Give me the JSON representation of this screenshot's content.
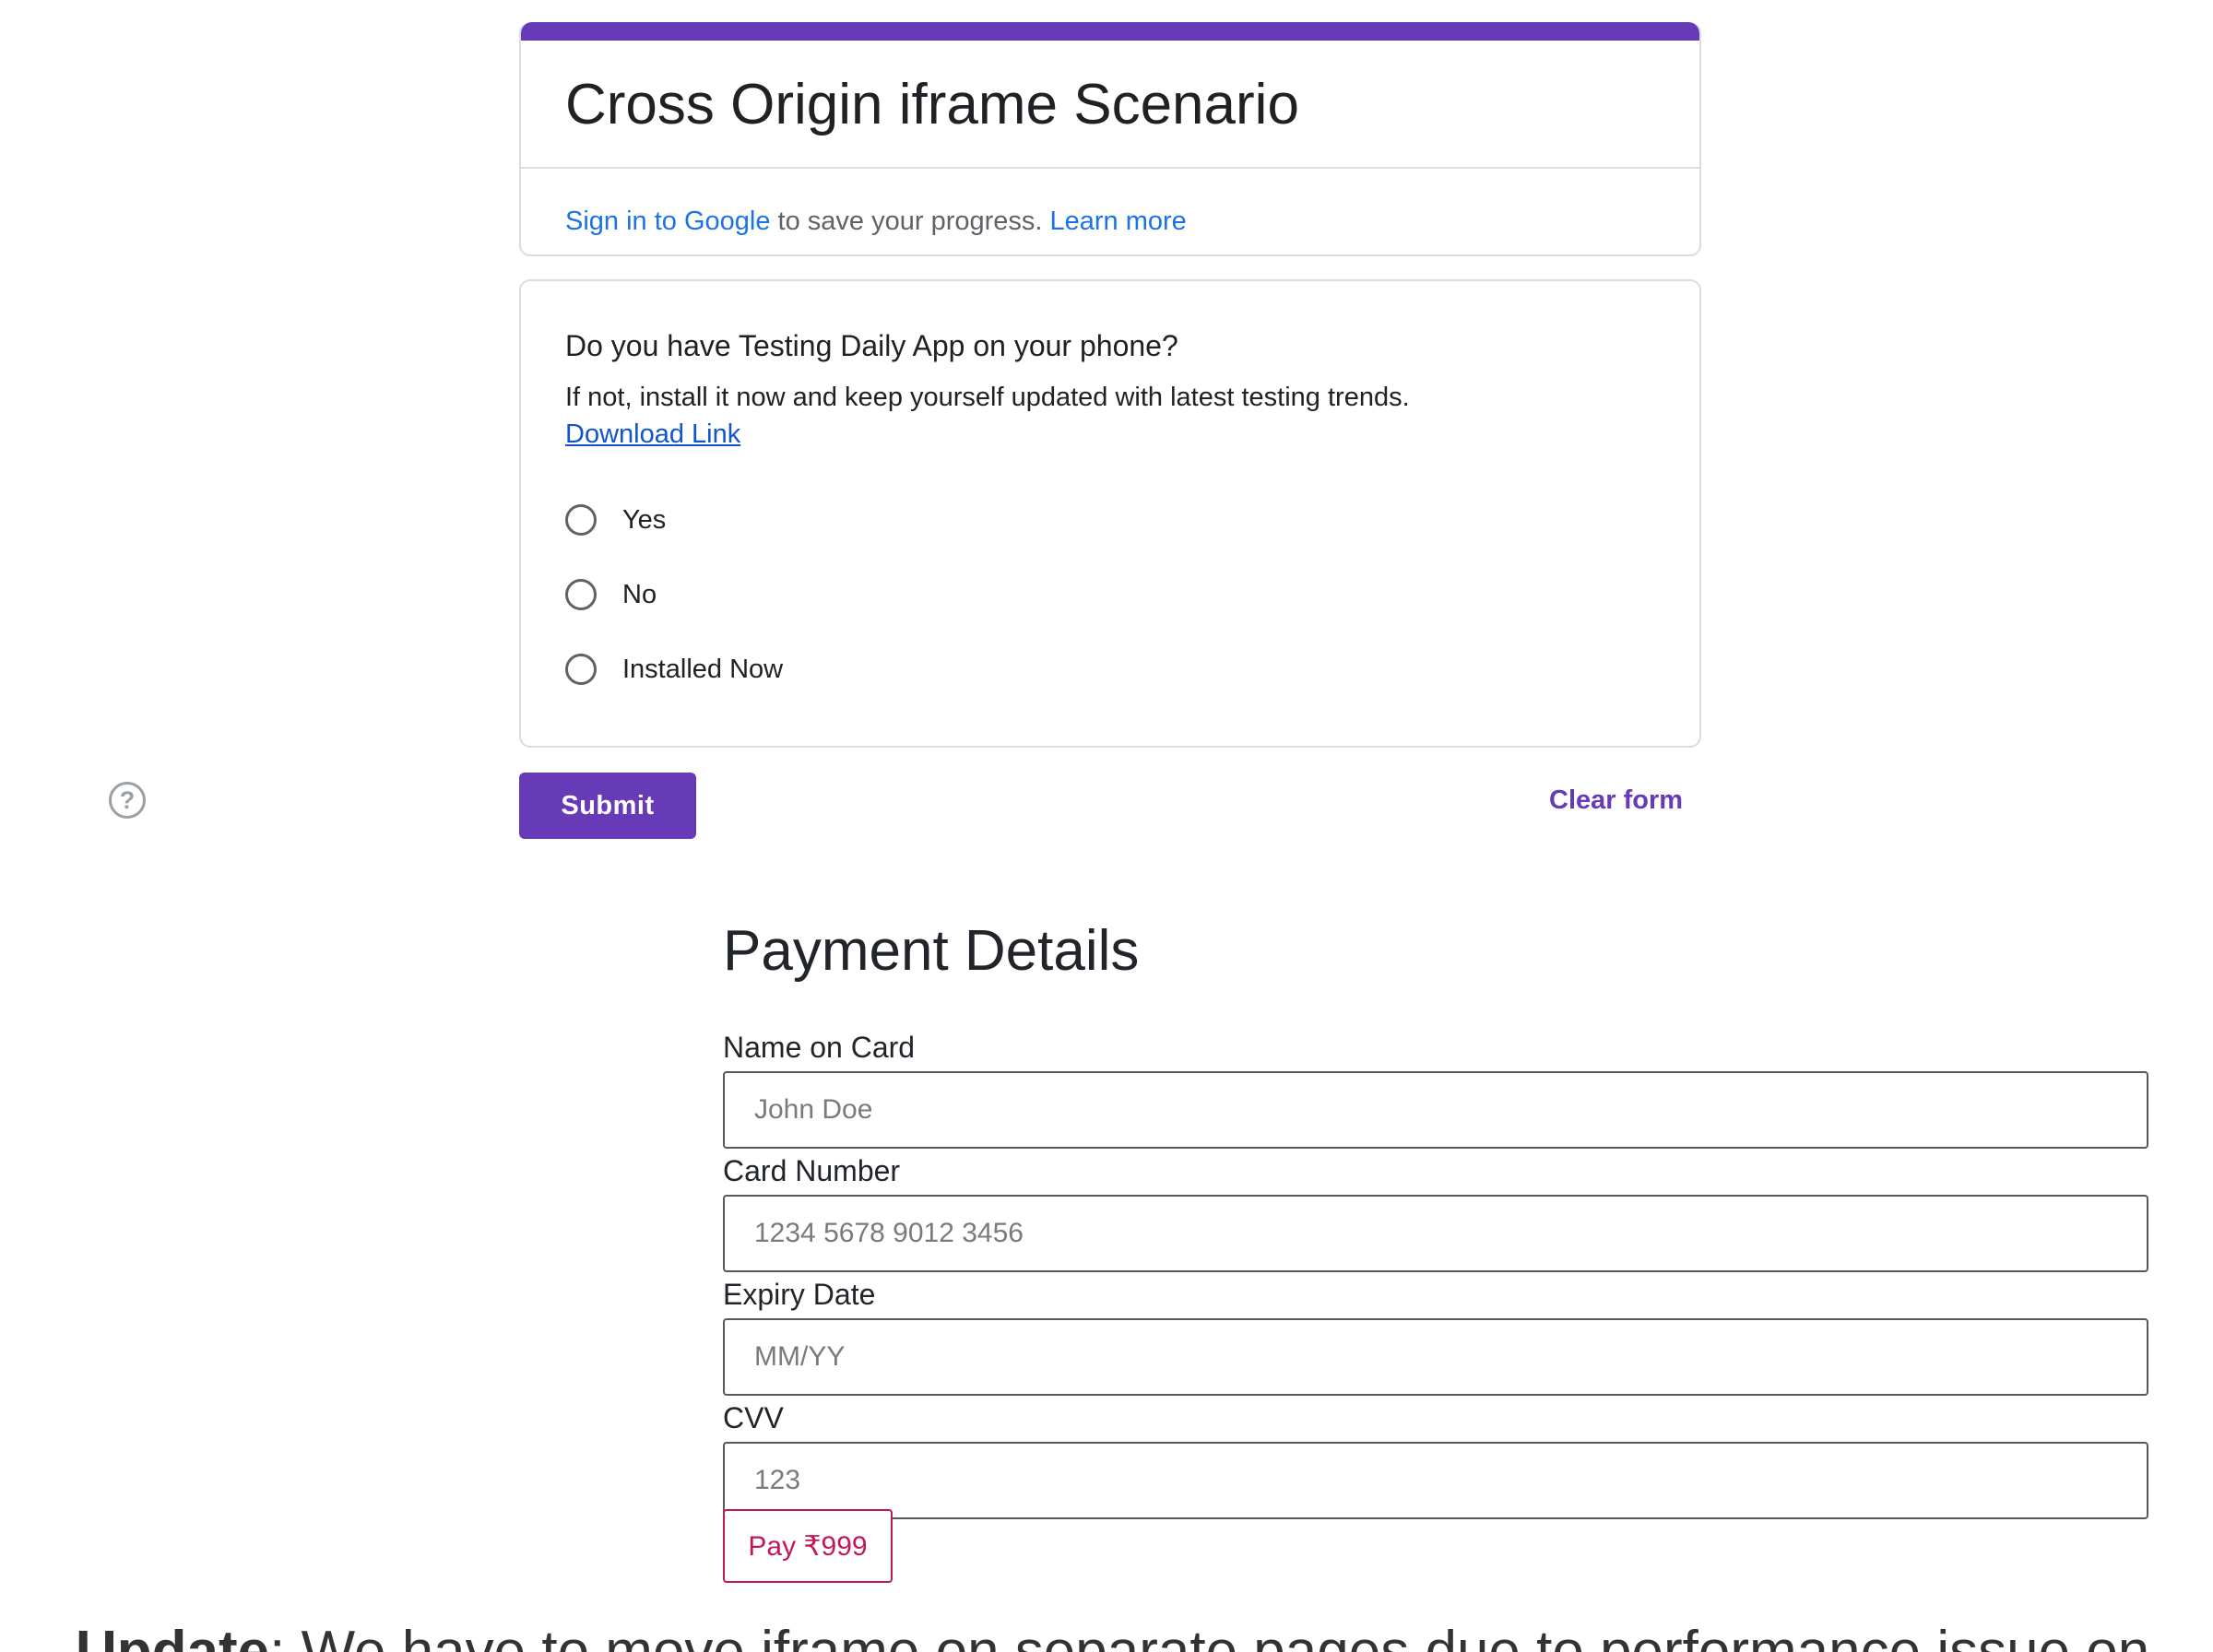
{
  "form": {
    "title": "Cross Origin iframe Scenario",
    "signin_link": "Sign in to Google",
    "signin_text": " to save your progress. ",
    "learn_more": "Learn more",
    "accent_color": "#673ab7"
  },
  "question": {
    "title": "Do you have Testing Daily App on your phone?",
    "description": "If not, install it now and keep yourself updated with latest testing trends.",
    "download_link": "Download Link",
    "options": [
      "Yes",
      "No",
      "Installed Now"
    ]
  },
  "actions": {
    "submit": "Submit",
    "clear": "Clear form",
    "help_icon": "?"
  },
  "payment": {
    "title": "Payment Details",
    "fields": [
      {
        "label": "Name on Card",
        "placeholder": "John Doe"
      },
      {
        "label": "Card Number",
        "placeholder": "1234 5678 9012 3456"
      },
      {
        "label": "Expiry Date",
        "placeholder": "MM/YY"
      },
      {
        "label": "CVV",
        "placeholder": "123"
      }
    ],
    "pay_button": "Pay ₹999",
    "pay_color": "#c2185b"
  },
  "update": {
    "prefix": "Update",
    "text": ": We have to move iframe on separate pages due to performance issue on"
  }
}
